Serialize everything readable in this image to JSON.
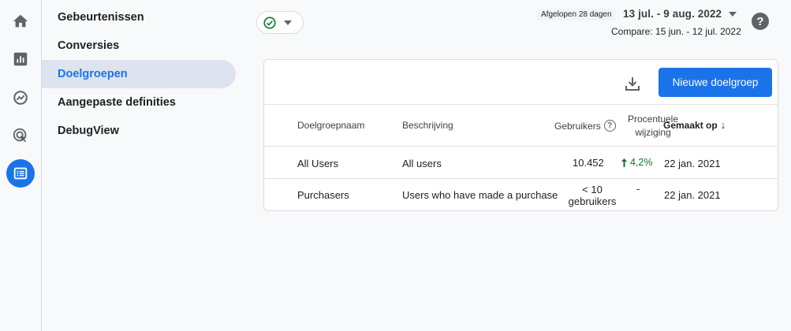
{
  "rail": {
    "icons": [
      "home-icon",
      "reports-icon",
      "explore-icon",
      "advertising-icon",
      "configure-icon"
    ],
    "active_index": 4
  },
  "subnav": {
    "items": [
      {
        "label": "Gebeurtenissen"
      },
      {
        "label": "Conversies"
      },
      {
        "label": "Doelgroepen"
      },
      {
        "label": "Aangepaste definities"
      },
      {
        "label": "DebugView"
      }
    ],
    "active_index": 2
  },
  "header": {
    "range_badge": "Afgelopen 28 dagen",
    "range_date": "13 jul. - 9 aug. 2022",
    "compare": "Compare: 15 jun. - 12 jul. 2022",
    "help": "?"
  },
  "card": {
    "new_button_label": "Nieuwe doelgroep",
    "columns": {
      "name": "Doelgroepnaam",
      "description": "Beschrijving",
      "users": "Gebruikers",
      "users_help": "?",
      "pct_line1": "Procentuele",
      "pct_line2": "wijziging",
      "created": "Gemaakt op",
      "sort_arrow": "↓"
    },
    "rows": [
      {
        "name": "All Users",
        "description": "All users",
        "users": "10.452",
        "users_line2": "",
        "pct": "4,2%",
        "created": "22 jan. 2021"
      },
      {
        "name": "Purchasers",
        "description": "Users who have made a purchase",
        "users": "< 10",
        "users_line2": "gebruikers",
        "pct": "-",
        "created": "22 jan. 2021"
      }
    ]
  },
  "colors": {
    "accent": "#1a73e8",
    "positive": "#137333",
    "check": "#188038"
  }
}
